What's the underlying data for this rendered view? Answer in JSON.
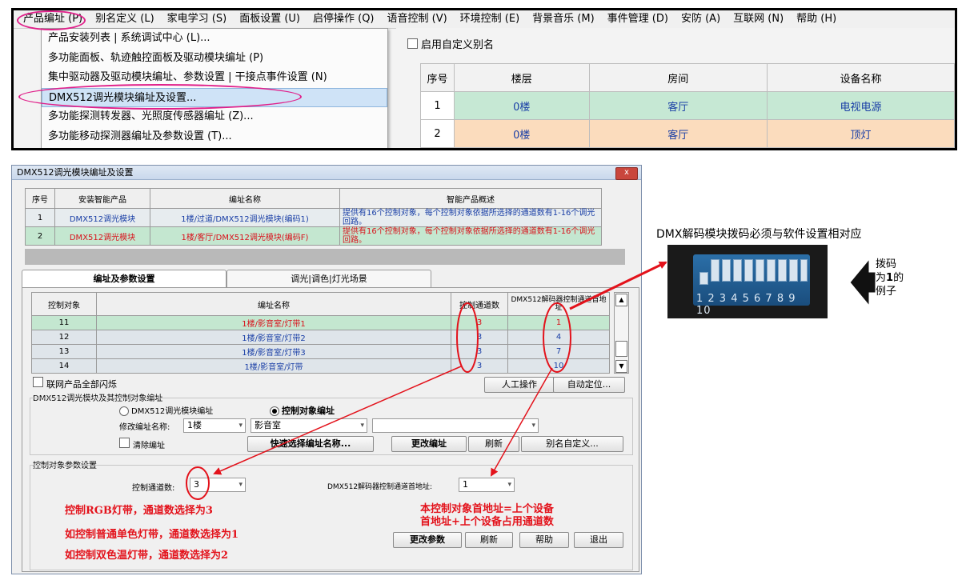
{
  "menubar": {
    "items": [
      "产品编址 (P)",
      "别名定义 (L)",
      "家电学习 (S)",
      "面板设置 (U)",
      "启停操作 (Q)",
      "语音控制 (V)",
      "环境控制 (E)",
      "背景音乐 (M)",
      "事件管理 (D)",
      "安防 (A)",
      "互联网 (N)",
      "帮助 (H)"
    ]
  },
  "dropdown": {
    "items": [
      "产品安装列表 | 系统调试中心 (L)...",
      "多功能面板、轨迹触控面板及驱动模块编址 (P)",
      "集中驱动器及驱动模块编址、参数设置 | 干接点事件设置 (N)",
      "DMX512调光模块编址及设置...",
      "多功能探测转发器、光照度传感器编址 (Z)...",
      "多功能移动探测器编址及参数设置 (T)..."
    ]
  },
  "alias": {
    "label": "启用自定义别名"
  },
  "top_table": {
    "headers": [
      "序号",
      "楼层",
      "房间",
      "设备名称"
    ],
    "rows": [
      [
        "1",
        "0楼",
        "客厅",
        "电视电源"
      ],
      [
        "2",
        "0楼",
        "客厅",
        "顶灯"
      ]
    ]
  },
  "dialog": {
    "title": "DMX512调光模块编址及设置",
    "close": "x",
    "product_table": {
      "headers": [
        "序号",
        "安装智能产品",
        "编址名称",
        "智能产品概述"
      ],
      "rows": [
        [
          "1",
          "DMX512调光模块",
          "1楼/过道/DMX512调光模块(编码1)",
          "提供有16个控制对象，每个控制对象依据所选择的通道数有1-16个调光回路。"
        ],
        [
          "2",
          "DMX512调光模块",
          "1楼/客厅/DMX512调光模块(编码F)",
          "提供有16个控制对象，每个控制对象依据所选择的通道数有1-16个调光回路。"
        ]
      ]
    },
    "tabs": [
      "编址及参数设置",
      "调光|调色|灯光场景"
    ],
    "control_table": {
      "headers": [
        "控制对象",
        "编址名称",
        "控制通道数",
        "DMX512解码器控制通道首地址"
      ],
      "rows": [
        [
          "11",
          "1楼/影音室/灯带1",
          "3",
          "1"
        ],
        [
          "12",
          "1楼/影音室/灯带2",
          "3",
          "4"
        ],
        [
          "13",
          "1楼/影音室/灯带3",
          "3",
          "7"
        ],
        [
          "14",
          "1楼/影音室/灯带",
          "3",
          "10"
        ]
      ]
    },
    "flash_all": "联网产品全部闪烁",
    "manual_btn": "人工操作",
    "auto_btn": "自动定位...",
    "addr_section": "DMX512调光模块及其控制对象编址",
    "radio_module": "DMX512调光模块编址",
    "radio_object": "控制对象编址",
    "modify_label": "修改编址名称:",
    "floor_value": "1楼",
    "room_value": "影音室",
    "clear_label": "清除编址",
    "quick_btn": "快速选择编址名称...",
    "change_addr_btn": "更改编址",
    "refresh_btn": "刷新",
    "alias_btn": "别名自定义...",
    "param_section": "控制对象参数设置",
    "channel_label": "控制通道数:",
    "channel_value": "3",
    "first_addr_label": "DMX512解码器控制通道首地址:",
    "first_addr_value": "1",
    "change_param_btn": "更改参数",
    "refresh2_btn": "刷新",
    "help_btn": "帮助",
    "exit_btn": "退出"
  },
  "annotations": {
    "rgb": "控制RGB灯带，通道数选择为3",
    "mono": "如控制普通单色灯带，通道数选择为1",
    "dual": "如控制双色温灯带，通道数选择为2",
    "first_addr_line1": "本控制对象首地址=上个设备",
    "first_addr_line2": "首地址+上个设备占用通道数",
    "dmx_note": "DMX解码模块拨码必须与软件设置相对应",
    "dip_line1": "拨码",
    "dip_line2a": "为",
    "dip_line2b": "1",
    "dip_line2c": "的",
    "dip_line3": "例子",
    "dip_numbers": "1 2 3 4 5 6 7 8 9 10"
  },
  "colors": {
    "accent_red": "#e3121b",
    "highlight_pink": "#e0208a",
    "blue_text": "#1a3fa6"
  }
}
